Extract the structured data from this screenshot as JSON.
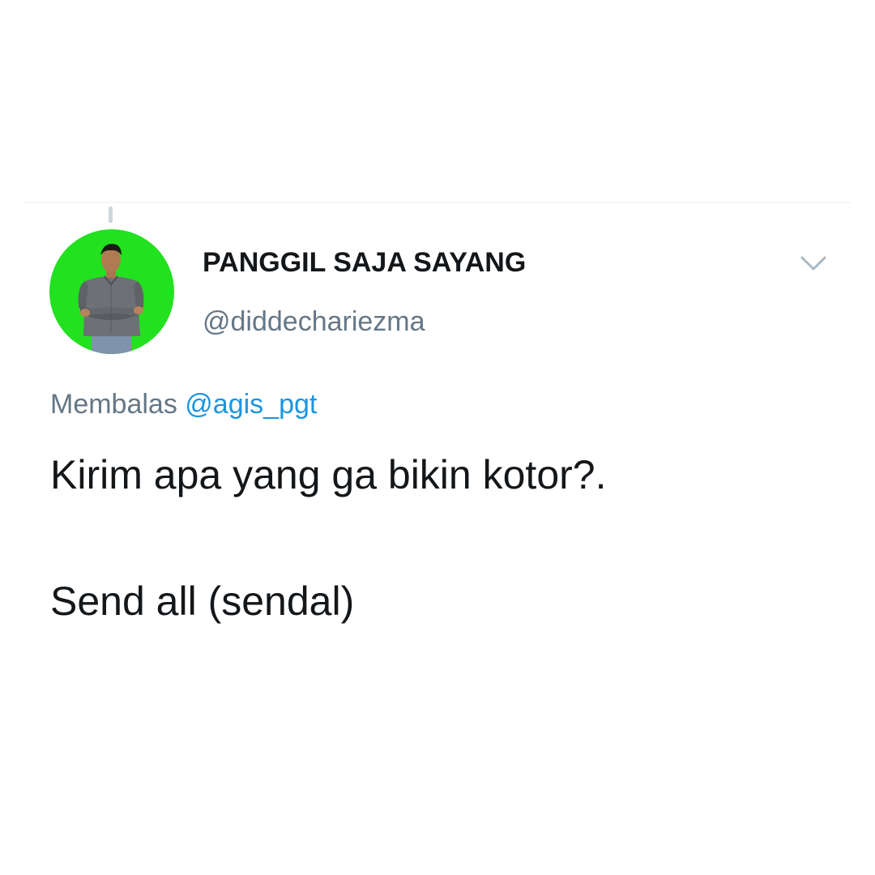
{
  "author": {
    "display_name": "PANGGIL SAJA SAYANG",
    "handle": "@diddechariezma",
    "avatar_bg": "#22e11f"
  },
  "reply": {
    "prefix": "Membalas",
    "mention": "@agis_pgt"
  },
  "tweet": {
    "lines": [
      "Kirim apa yang ga bikin kotor?.",
      "Send all (sendal)"
    ]
  },
  "colors": {
    "text_primary": "#14171a",
    "text_secondary": "#657786",
    "link": "#1b95e0"
  },
  "icons": {
    "menu": "chevron-down-icon"
  }
}
